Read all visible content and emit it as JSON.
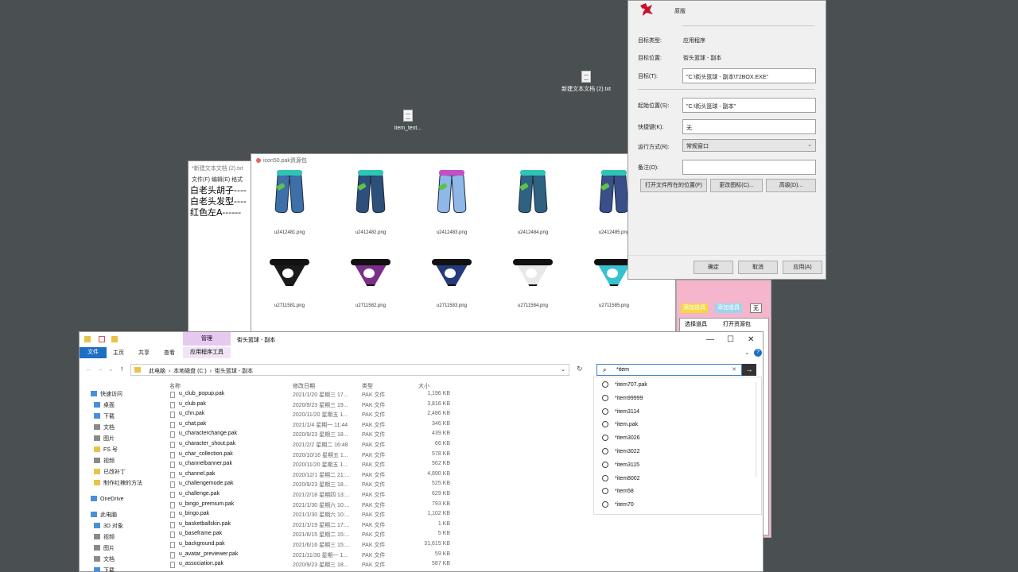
{
  "desktop": {
    "icons": [
      {
        "label": "item_text..."
      },
      {
        "label": "新建文本文档 (2).txt"
      }
    ]
  },
  "notepad": {
    "title": "*新建文本文档 (2).txt",
    "menu": "文件(F)  编辑(E)  格式",
    "lines": [
      "白老头胡子----",
      "白老头发型----",
      "红色左A------"
    ]
  },
  "viewer": {
    "title": "icon50.pak资源包",
    "items": [
      {
        "label": "u2412481.png",
        "waist": "#2fc4b5",
        "color": "#3f6fa8"
      },
      {
        "label": "u2412482.png",
        "waist": "#2fc4b5",
        "color": "#2d4f7a"
      },
      {
        "label": "u2412483.png",
        "waist": "#c24fc4",
        "color": "#8fb8e8"
      },
      {
        "label": "u2412484.png",
        "waist": "#2fc4b5",
        "color": "#2f6280"
      },
      {
        "label": "u2412485.png",
        "waist": "#2fc4b5",
        "color": "#3a4e8a"
      },
      {
        "label": "u2711581.png",
        "cloth": "#1a1a1a"
      },
      {
        "label": "u2711582.png",
        "cloth": "#7b2f8a"
      },
      {
        "label": "u2711583.png",
        "cloth": "#243a7a"
      },
      {
        "label": "u2711584.png",
        "cloth": "#e8e8e8"
      },
      {
        "label": "u2711585.png",
        "cloth": "#35c3d1"
      }
    ]
  },
  "props": {
    "name": "原版",
    "labels": {
      "target_type": "目标类型:",
      "target_location": "目标位置:",
      "target": "目标(T):",
      "start_in": "起始位置(S):",
      "shortcut": "快捷键(K):",
      "run": "运行方式(R):",
      "comment": "备注(O):"
    },
    "values": {
      "target_type": "应用程序",
      "target_location": "街头篮球 - 副本",
      "target": "\"C:\\街头篮球 - 副本\\T2BOX.EXE\"",
      "start_in": "\"C:\\街头篮球 - 副本\"",
      "shortcut": "无",
      "run": "常规窗口",
      "comment": ""
    },
    "buttons": {
      "open_location": "打开文件所在的位置(F)",
      "change_icon": "更改图标(C)...",
      "advanced": "高级(D)...",
      "ok": "确定",
      "cancel": "取消",
      "apply": "应用(A)"
    }
  },
  "pink": {
    "tags": [
      "添加道具",
      "添加道具",
      "无"
    ],
    "col1": "选择道具",
    "col2": "打开资源包"
  },
  "explorer": {
    "ribbon_context": "管理",
    "title": "街头篮球 - 副本",
    "tabs": [
      "文件",
      "主页",
      "共享",
      "查看",
      "应用程序工具"
    ],
    "path": [
      "此电脑",
      "本地磁盘 (C:)",
      "街头篮球 - 副本"
    ],
    "search_value": "*item",
    "columns": [
      "名称",
      "修改日期",
      "类型",
      "大小"
    ],
    "nav": [
      {
        "label": "快速访问",
        "c": ""
      },
      {
        "label": "桌面",
        "c": ""
      },
      {
        "label": "下载",
        "c": ""
      },
      {
        "label": "文档",
        "c": "g"
      },
      {
        "label": "图片",
        "c": "g"
      },
      {
        "label": "FS 号",
        "c": "y"
      },
      {
        "label": "视频",
        "c": "g"
      },
      {
        "label": "已改补丁",
        "c": "y"
      },
      {
        "label": "制作红辣的方法",
        "c": "y"
      },
      {
        "label": "",
        "c": "none"
      },
      {
        "label": "OneDrive",
        "c": ""
      },
      {
        "label": "",
        "c": "none"
      },
      {
        "label": "此电脑",
        "c": ""
      },
      {
        "label": "3D 对象",
        "c": ""
      },
      {
        "label": "视频",
        "c": "g"
      },
      {
        "label": "图片",
        "c": "g"
      },
      {
        "label": "文档",
        "c": "g"
      },
      {
        "label": "下载",
        "c": ""
      }
    ],
    "files": [
      {
        "name": "u_club_popup.pak",
        "date": "2021/1/20 星期三 17...",
        "type": "PAK 文件",
        "size": "1,196 KB"
      },
      {
        "name": "u_club.pak",
        "date": "2020/9/23 星期三 19...",
        "type": "PAK 文件",
        "size": "3,816 KB"
      },
      {
        "name": "u_chn.pak",
        "date": "2020/11/20 星期五 1...",
        "type": "PAK 文件",
        "size": "2,486 KB"
      },
      {
        "name": "u_chat.pak",
        "date": "2021/1/4 星期一 11:44",
        "type": "PAK 文件",
        "size": "346 KB"
      },
      {
        "name": "u_characterchange.pak",
        "date": "2020/9/23 星期三 18...",
        "type": "PAK 文件",
        "size": "439 KB"
      },
      {
        "name": "u_character_shout.pak",
        "date": "2021/2/2 星期二 16:48",
        "type": "PAK 文件",
        "size": "66 KB"
      },
      {
        "name": "u_char_collection.pak",
        "date": "2020/10/16 星期五 1...",
        "type": "PAK 文件",
        "size": "578 KB"
      },
      {
        "name": "u_channelbanner.pak",
        "date": "2020/11/20 星期五 1...",
        "type": "PAK 文件",
        "size": "562 KB"
      },
      {
        "name": "u_channel.pak",
        "date": "2020/12/1 星期二 21:...",
        "type": "PAK 文件",
        "size": "4,890 KB"
      },
      {
        "name": "u_challengemode.pak",
        "date": "2020/9/23 星期三 18...",
        "type": "PAK 文件",
        "size": "525 KB"
      },
      {
        "name": "u_challenge.pak",
        "date": "2021/2/18 星期四 13:...",
        "type": "PAK 文件",
        "size": "629 KB"
      },
      {
        "name": "u_bingo_premium.pak",
        "date": "2021/1/30 星期六 10:...",
        "type": "PAK 文件",
        "size": "793 KB"
      },
      {
        "name": "u_bingo.pak",
        "date": "2021/1/30 星期六 10:...",
        "type": "PAK 文件",
        "size": "1,102 KB"
      },
      {
        "name": "u_basketballskin.pak",
        "date": "2021/1/19 星期二 17:...",
        "type": "PAK 文件",
        "size": "1 KB"
      },
      {
        "name": "u_baseframe.pak",
        "date": "2021/6/15 星期二 15:...",
        "type": "PAK 文件",
        "size": "5 KB"
      },
      {
        "name": "u_background.pak",
        "date": "2021/6/16 星期三 15:...",
        "type": "PAK 文件",
        "size": "31,615 KB"
      },
      {
        "name": "u_avatar_previewer.pak",
        "date": "2021/11/30 星期一 1...",
        "type": "PAK 文件",
        "size": "59 KB"
      },
      {
        "name": "u_association.pak",
        "date": "2020/9/23 星期三 18...",
        "type": "PAK 文件",
        "size": "587 KB"
      }
    ],
    "suggestions": [
      "*item707.pak",
      "*item99999",
      "*item3114",
      "*item.pak",
      "*item3026",
      "*item3022",
      "*item3115",
      "*item8002",
      "*item58",
      "*item70"
    ]
  }
}
